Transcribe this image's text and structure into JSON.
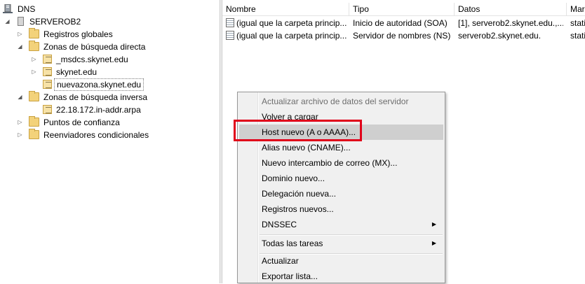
{
  "tree": {
    "root": "DNS",
    "server": "SERVEROB2",
    "items": [
      {
        "label": "Registros globales"
      },
      {
        "label": "Zonas de búsqueda directa"
      },
      {
        "label": "_msdcs.skynet.edu"
      },
      {
        "label": "skynet.edu"
      },
      {
        "label": "nuevazona.skynet.edu"
      },
      {
        "label": "Zonas de búsqueda inversa"
      },
      {
        "label": "22.18.172.in-addr.arpa"
      },
      {
        "label": "Puntos de confianza"
      },
      {
        "label": "Reenviadores condicionales"
      }
    ]
  },
  "list": {
    "columns": [
      "Nombre",
      "Tipo",
      "Datos",
      "Mar"
    ],
    "rows": [
      {
        "name": "(igual que la carpeta princip...",
        "type": "Inicio de autoridad (SOA)",
        "data": "[1], serverob2.skynet.edu.,...",
        "extra": "stati"
      },
      {
        "name": "(igual que la carpeta princip...",
        "type": "Servidor de nombres (NS)",
        "data": "serverob2.skynet.edu.",
        "extra": "stati"
      }
    ]
  },
  "menu": {
    "items": [
      {
        "label": "Actualizar archivo de datos del servidor"
      },
      {
        "label": "Volver a cargar"
      },
      {
        "label": "Host nuevo (A o AAAA)..."
      },
      {
        "label": "Alias nuevo (CNAME)..."
      },
      {
        "label": "Nuevo intercambio de correo (MX)..."
      },
      {
        "label": "Dominio nuevo..."
      },
      {
        "label": "Delegación nueva..."
      },
      {
        "label": "Registros nuevos..."
      },
      {
        "label": "DNSSEC"
      },
      {
        "label": "Todas las tareas"
      },
      {
        "label": "Actualizar"
      },
      {
        "label": "Exportar lista..."
      }
    ]
  },
  "colors": {
    "highlight_box": "#e0001a",
    "menu_hover": "#cfcfcf",
    "menu_bg": "#f0f0f0"
  }
}
